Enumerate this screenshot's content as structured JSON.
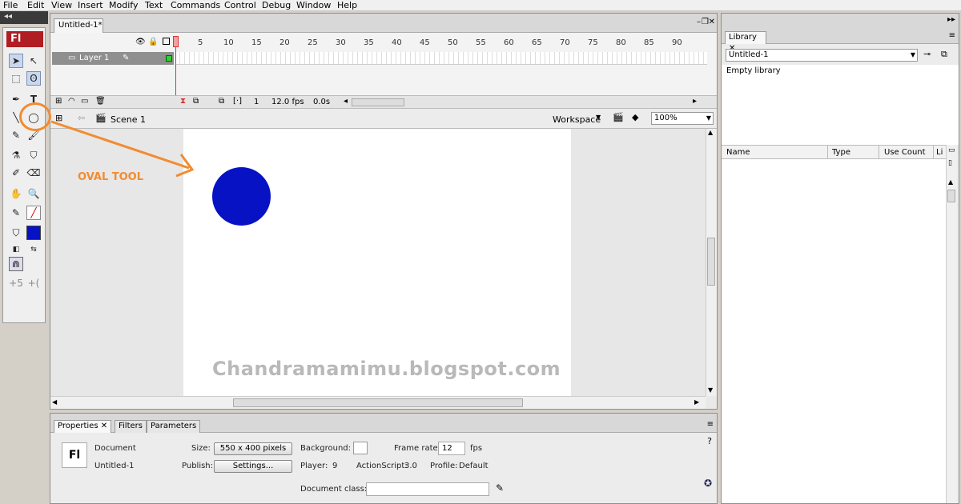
{
  "menu": [
    "File",
    "Edit",
    "View",
    "Insert",
    "Modify",
    "Text",
    "Commands",
    "Control",
    "Debug",
    "Window",
    "Help"
  ],
  "toolbox": {
    "logo": "Fl"
  },
  "document": {
    "tab_title": "Untitled-1*"
  },
  "timeline": {
    "ticks": [
      "5",
      "10",
      "15",
      "20",
      "25",
      "30",
      "35",
      "40",
      "45",
      "50",
      "55",
      "60",
      "65",
      "70",
      "75",
      "80",
      "85",
      "90"
    ],
    "layer_name": "Layer 1",
    "current_frame": "1",
    "fps": "12.0 fps",
    "elapsed": "0.0s"
  },
  "edit_bar": {
    "scene": "Scene 1",
    "workspace": "Workspace",
    "zoom": "100%"
  },
  "stage": {
    "shape_color": "#0712c4",
    "watermark": "Chandramamimu.blogspot.com"
  },
  "annotation": {
    "label": "OVAL TOOL",
    "color": "#f28b30"
  },
  "properties": {
    "tabs": [
      "Properties",
      "Filters",
      "Parameters"
    ],
    "doc_type": "Document",
    "doc_name": "Untitled-1",
    "icon": "Fl",
    "size_label": "Size:",
    "size_value": "550 x 400 pixels",
    "background_label": "Background:",
    "frame_rate_label": "Frame rate:",
    "frame_rate_value": "12",
    "fps_unit": "fps",
    "publish_label": "Publish:",
    "settings_button": "Settings...",
    "player_label": "Player:",
    "player_value": "9",
    "actionscript_label": "ActionScript:",
    "actionscript_value": "3.0",
    "profile_label": "Profile:",
    "profile_value": "Default",
    "document_class_label": "Document class:"
  },
  "library": {
    "tab": "Library",
    "selected_doc": "Untitled-1",
    "empty_text": "Empty library",
    "columns": [
      "Name",
      "Type",
      "Use Count",
      "Li"
    ]
  }
}
